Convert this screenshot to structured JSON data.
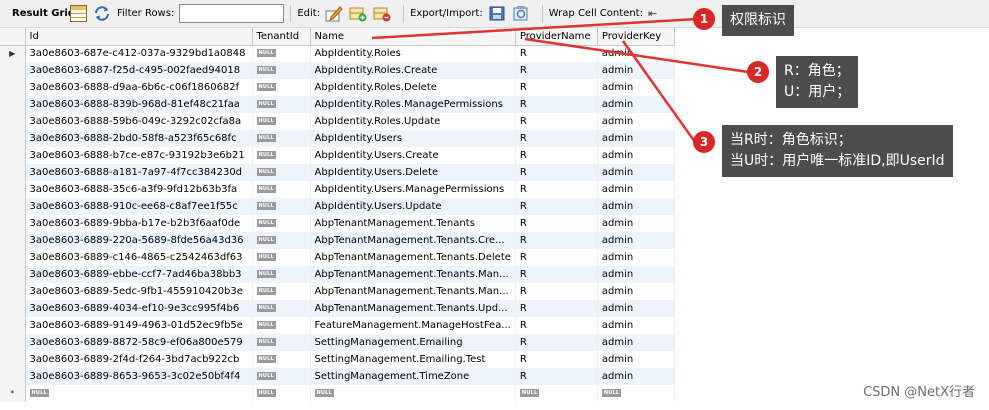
{
  "toolbar": {
    "result_grid_label": "Result Grid",
    "filter_rows_label": "Filter Rows:",
    "filter_rows_value": "",
    "edit_label": "Edit:",
    "export_import_label": "Export/Import:",
    "wrap_cell_label": "Wrap Cell Content:",
    "icons": [
      "grid-icon",
      "refresh-icon",
      "edit-icon",
      "add-row-icon",
      "delete-row-icon",
      "export-icon",
      "import-icon",
      "wrap-icon"
    ]
  },
  "grid": {
    "columns": [
      "Id",
      "TenantId",
      "Name",
      "ProviderName",
      "ProviderKey"
    ],
    "null_label": "NULL",
    "current_row_marker": "▶",
    "new_row_marker": "*",
    "rows": [
      {
        "id": "3a0e8603-687e-c412-037a-9329bd1a0848",
        "name": "AbpIdentity.Roles",
        "provider_name": "R",
        "provider_key": "admin"
      },
      {
        "id": "3a0e8603-6887-f25d-c495-002faed94018",
        "name": "AbpIdentity.Roles.Create",
        "provider_name": "R",
        "provider_key": "admin"
      },
      {
        "id": "3a0e8603-6888-d9aa-6b6c-c06f1860682f",
        "name": "AbpIdentity.Roles.Delete",
        "provider_name": "R",
        "provider_key": "admin"
      },
      {
        "id": "3a0e8603-6888-839b-968d-81ef48c21faa",
        "name": "AbpIdentity.Roles.ManagePermissions",
        "provider_name": "R",
        "provider_key": "admin"
      },
      {
        "id": "3a0e8603-6888-59b6-049c-3292c02cfa8a",
        "name": "AbpIdentity.Roles.Update",
        "provider_name": "R",
        "provider_key": "admin"
      },
      {
        "id": "3a0e8603-6888-2bd0-58f8-a523f65c68fc",
        "name": "AbpIdentity.Users",
        "provider_name": "R",
        "provider_key": "admin"
      },
      {
        "id": "3a0e8603-6888-b7ce-e87c-93192b3e6b21",
        "name": "AbpIdentity.Users.Create",
        "provider_name": "R",
        "provider_key": "admin"
      },
      {
        "id": "3a0e8603-6888-a181-7a97-4f7cc384230d",
        "name": "AbpIdentity.Users.Delete",
        "provider_name": "R",
        "provider_key": "admin"
      },
      {
        "id": "3a0e8603-6888-35c6-a3f9-9fd12b63b3fa",
        "name": "AbpIdentity.Users.ManagePermissions",
        "provider_name": "R",
        "provider_key": "admin"
      },
      {
        "id": "3a0e8603-6888-910c-ee68-c8af7ee1f55c",
        "name": "AbpIdentity.Users.Update",
        "provider_name": "R",
        "provider_key": "admin"
      },
      {
        "id": "3a0e8603-6889-9bba-b17e-b2b3f6aaf0de",
        "name": "AbpTenantManagement.Tenants",
        "provider_name": "R",
        "provider_key": "admin"
      },
      {
        "id": "3a0e8603-6889-220a-5689-8fde56a43d36",
        "name": "AbpTenantManagement.Tenants.Cre...",
        "provider_name": "R",
        "provider_key": "admin"
      },
      {
        "id": "3a0e8603-6889-c146-4865-c2542463df63",
        "name": "AbpTenantManagement.Tenants.Delete",
        "provider_name": "R",
        "provider_key": "admin"
      },
      {
        "id": "3a0e8603-6889-ebbe-ccf7-7ad46ba38bb3",
        "name": "AbpTenantManagement.Tenants.Man...",
        "provider_name": "R",
        "provider_key": "admin"
      },
      {
        "id": "3a0e8603-6889-5edc-9fb1-455910420b3e",
        "name": "AbpTenantManagement.Tenants.Man...",
        "provider_name": "R",
        "provider_key": "admin"
      },
      {
        "id": "3a0e8603-6889-4034-ef10-9e3cc995f4b6",
        "name": "AbpTenantManagement.Tenants.Upd...",
        "provider_name": "R",
        "provider_key": "admin"
      },
      {
        "id": "3a0e8603-6889-9149-4963-01d52ec9fb5e",
        "name": "FeatureManagement.ManageHostFea...",
        "provider_name": "R",
        "provider_key": "admin"
      },
      {
        "id": "3a0e8603-6889-8872-58c9-ef06a800e579",
        "name": "SettingManagement.Emailing",
        "provider_name": "R",
        "provider_key": "admin"
      },
      {
        "id": "3a0e8603-6889-2f4d-f264-3bd7acb922cb",
        "name": "SettingManagement.Emailing.Test",
        "provider_name": "R",
        "provider_key": "admin"
      },
      {
        "id": "3a0e8603-6889-8653-9653-3c02e50bf4f4",
        "name": "SettingManagement.TimeZone",
        "provider_name": "R",
        "provider_key": "admin"
      }
    ]
  },
  "annotations": [
    {
      "number": "1",
      "lines": [
        "权限标识"
      ]
    },
    {
      "number": "2",
      "lines": [
        "R：角色；",
        "U：用户；"
      ]
    },
    {
      "number": "3",
      "lines": [
        "当R时：角色标识；",
        "当U时：用户唯一标准ID,即UserId"
      ]
    }
  ],
  "colors": {
    "badge": "#d92727",
    "callout_bg": "#4d4d4d",
    "arrow": "#e23333",
    "row_alt": "#eef4fb"
  },
  "watermark": "CSDN @NetX行者"
}
